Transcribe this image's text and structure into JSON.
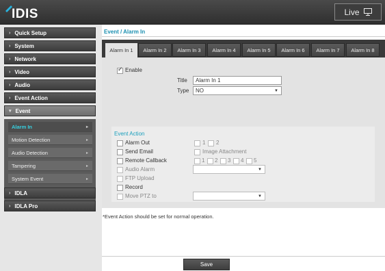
{
  "app": {
    "logo_text": "IDIS",
    "live_label": "Live"
  },
  "colors": {
    "accent": "#1a9fbd",
    "active_sub": "#37d0e0",
    "topbar": "#3a3a3a"
  },
  "sidebar": {
    "items": [
      {
        "label": "Quick Setup",
        "icon": "chevron-right-icon"
      },
      {
        "label": "System",
        "icon": "chevron-right-icon"
      },
      {
        "label": "Network",
        "icon": "chevron-right-icon"
      },
      {
        "label": "Video",
        "icon": "chevron-right-icon"
      },
      {
        "label": "Audio",
        "icon": "chevron-right-icon"
      },
      {
        "label": "Event Action",
        "icon": "chevron-right-icon"
      },
      {
        "label": "Event",
        "icon": "chevron-down-icon"
      },
      {
        "label": "IDLA",
        "icon": "chevron-right-icon"
      },
      {
        "label": "IDLA Pro",
        "icon": "chevron-right-icon"
      }
    ],
    "event_sub": [
      {
        "label": "Alarm In"
      },
      {
        "label": "Motion Detection"
      },
      {
        "label": "Audio Detection"
      },
      {
        "label": "Tampering"
      },
      {
        "label": "System Event"
      }
    ]
  },
  "breadcrumb": "Event / Alarm In",
  "tabs": [
    "Alarm In 1",
    "Alarm In 2",
    "Alarm In 3",
    "Alarm In 4",
    "Alarm In 5",
    "Alarm In 6",
    "Alarm In 7",
    "Alarm In 8"
  ],
  "form": {
    "enable_label": "Enable",
    "title_label": "Title",
    "title_value": "Alarm In 1",
    "type_label": "Type",
    "type_value": "NO"
  },
  "event_action": {
    "title": "Event Action",
    "alarm_out": "Alarm Out",
    "alarm_out_opts": [
      "1",
      "2"
    ],
    "send_email": "Send Email",
    "image_attachment": "Image Attachment",
    "remote_callback": "Remote Callback",
    "callback_opts": [
      "1",
      "2",
      "3",
      "4",
      "5"
    ],
    "audio_alarm": "Audio Alarm",
    "ftp_upload": "FTP Upload",
    "record": "Record",
    "move_ptz": "Move PTZ to"
  },
  "note": "*Event Action should be set for normal operation.",
  "save_label": "Save"
}
